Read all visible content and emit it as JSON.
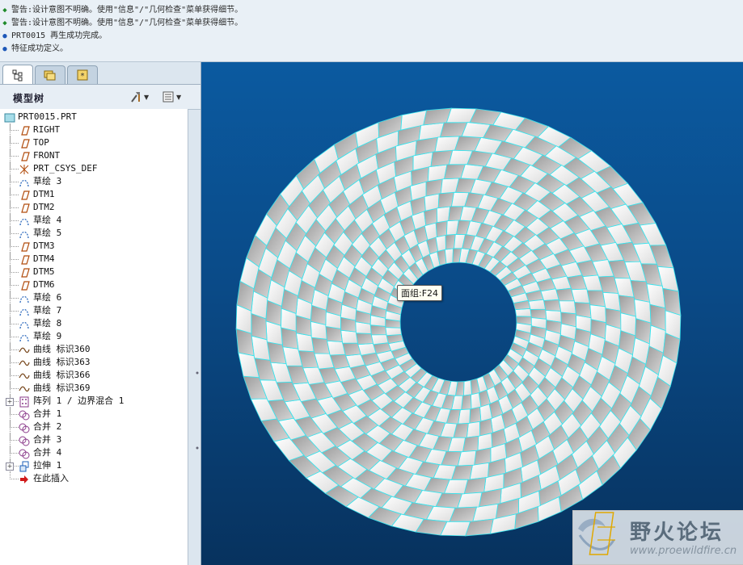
{
  "messages": [
    {
      "kind": "ok",
      "text": "警告:设计意图不明确。使用\"信息\"/\"几何检查\"菜单获得细节。"
    },
    {
      "kind": "ok",
      "text": "警告:设计意图不明确。使用\"信息\"/\"几何检查\"菜单获得细节。"
    },
    {
      "kind": "info",
      "text": "PRT0015 再生成功完成。"
    },
    {
      "kind": "info",
      "text": "特征成功定义。"
    }
  ],
  "panel": {
    "tabs": [
      {
        "name": "model-tree-tab-icon",
        "active": true
      },
      {
        "name": "folder-browser-tab-icon",
        "active": false
      },
      {
        "name": "favorites-tab-icon",
        "active": false
      }
    ],
    "title": "模型树"
  },
  "tree": {
    "root": "PRT0015.PRT",
    "items": [
      {
        "icon": "datum-plane-icon",
        "label": "RIGHT"
      },
      {
        "icon": "datum-plane-icon",
        "label": "TOP"
      },
      {
        "icon": "datum-plane-icon",
        "label": "FRONT"
      },
      {
        "icon": "csys-icon",
        "label": "PRT_CSYS_DEF"
      },
      {
        "icon": "sketch-icon",
        "label": "草绘 3"
      },
      {
        "icon": "datum-plane-icon",
        "label": "DTM1"
      },
      {
        "icon": "datum-plane-icon",
        "label": "DTM2"
      },
      {
        "icon": "sketch-icon",
        "label": "草绘 4"
      },
      {
        "icon": "sketch-icon",
        "label": "草绘 5"
      },
      {
        "icon": "datum-plane-icon",
        "label": "DTM3"
      },
      {
        "icon": "datum-plane-icon",
        "label": "DTM4"
      },
      {
        "icon": "datum-plane-icon",
        "label": "DTM5"
      },
      {
        "icon": "datum-plane-icon",
        "label": "DTM6"
      },
      {
        "icon": "sketch-icon",
        "label": "草绘 6"
      },
      {
        "icon": "sketch-icon",
        "label": "草绘 7"
      },
      {
        "icon": "sketch-icon",
        "label": "草绘 8"
      },
      {
        "icon": "sketch-icon",
        "label": "草绘 9"
      },
      {
        "icon": "curve-icon",
        "label": "曲线 标识360"
      },
      {
        "icon": "curve-icon",
        "label": "曲线 标识363"
      },
      {
        "icon": "curve-icon",
        "label": "曲线 标识366"
      },
      {
        "icon": "curve-icon",
        "label": "曲线 标识369"
      },
      {
        "icon": "pattern-icon",
        "label": "阵列 1 / 边界混合 1",
        "expandable": true
      },
      {
        "icon": "merge-icon",
        "label": "合并 1"
      },
      {
        "icon": "merge-icon",
        "label": "合并 2"
      },
      {
        "icon": "merge-icon",
        "label": "合并 3"
      },
      {
        "icon": "merge-icon",
        "label": "合并 4"
      },
      {
        "icon": "extrude-icon",
        "label": "拉伸 1",
        "expandable": true
      },
      {
        "icon": "insert-here-icon",
        "label": "在此插入"
      }
    ]
  },
  "viewport": {
    "tooltip": "面组:F24"
  },
  "watermark": {
    "title": "野火论坛",
    "url": "www.proewildfire.cn"
  },
  "colors": {
    "edge": "#35e4ee",
    "background_top": "#0b5aa0",
    "background_bottom": "#07325e"
  }
}
